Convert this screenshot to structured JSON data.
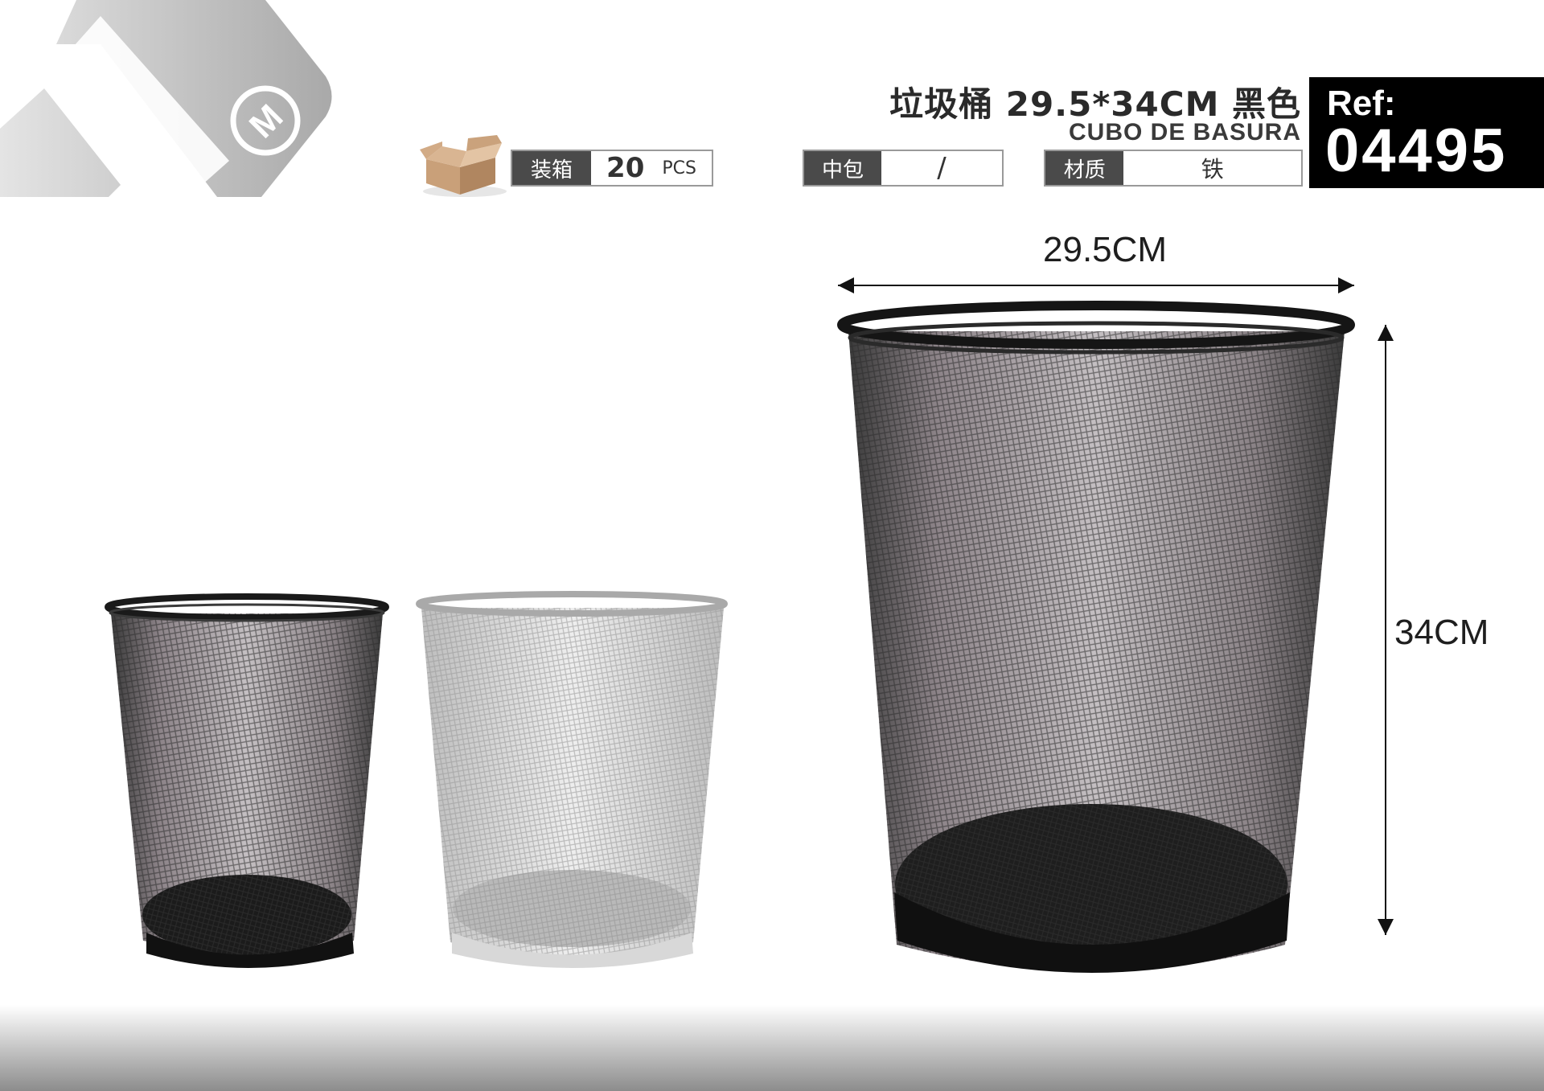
{
  "header": {
    "title_zh": "垃圾桶 29.5*34CM 黑色",
    "title_es": "CUBO DE BASURA"
  },
  "reference": {
    "label": "Ref:",
    "value": "04495"
  },
  "specs": {
    "carton": {
      "label": "装箱",
      "qty": "20",
      "unit": "PCS"
    },
    "inner_pack": {
      "label": "中包",
      "value": "/"
    },
    "material": {
      "label": "材质",
      "value": "铁"
    }
  },
  "dimensions": {
    "width": "29.5CM",
    "height": "34CM"
  },
  "colors": {
    "black_variant": "#1a1a1a",
    "silver_variant": "#c8c8c8",
    "ref_background": "#000000"
  },
  "icons": [
    "brand-logo-icon",
    "carton-box-icon"
  ]
}
